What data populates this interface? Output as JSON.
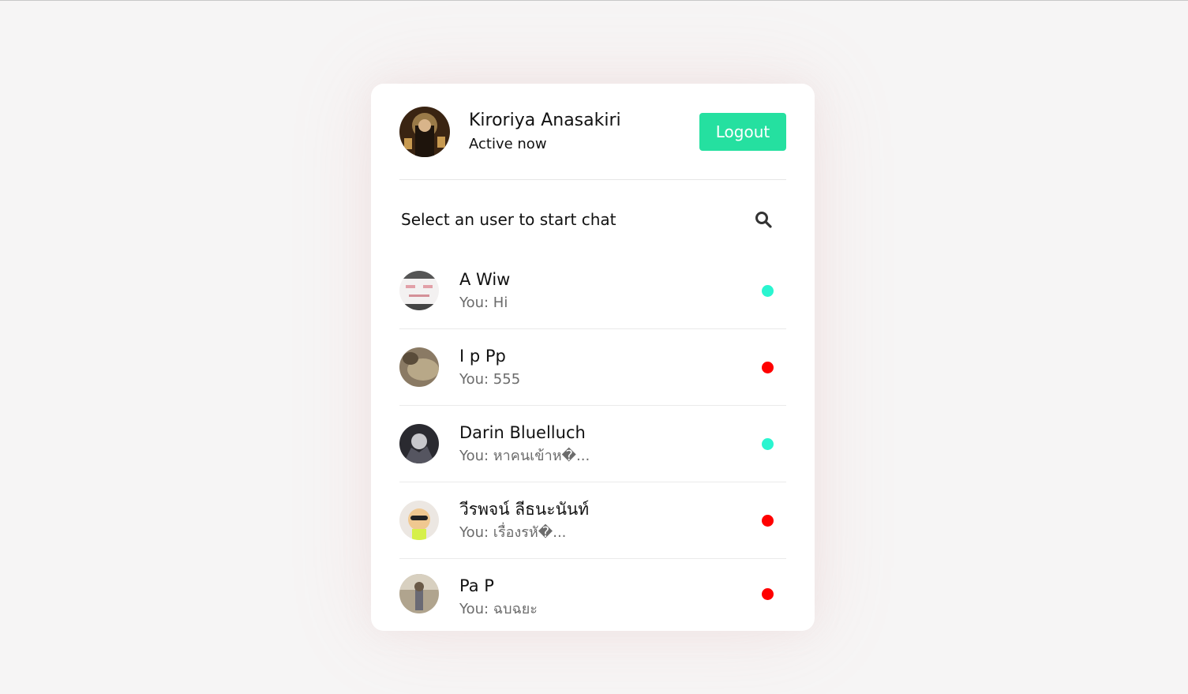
{
  "header": {
    "name": "Kiroriya Anasakiri",
    "status": "Active now",
    "logout_label": "Logout"
  },
  "search": {
    "label": "Select an user to start chat",
    "icon": "search-icon"
  },
  "colors": {
    "online": "#2af5d0",
    "offline": "#ff0000",
    "logout_bg": "#25e0a0"
  },
  "users": [
    {
      "name": "A Wiw",
      "message": "You: Hi",
      "status": "online"
    },
    {
      "name": "I p Pp",
      "message": "You: 555",
      "status": "offline"
    },
    {
      "name": "Darin Bluelluch",
      "message": "You: หาคนเข้าห�...",
      "status": "online"
    },
    {
      "name": "วีรพจน์ ลีธนะนันท์",
      "message": "You: เรื่องรหั�...",
      "status": "offline"
    },
    {
      "name": "Pa P",
      "message": "You: ฉบฉยะ",
      "status": "offline"
    }
  ]
}
